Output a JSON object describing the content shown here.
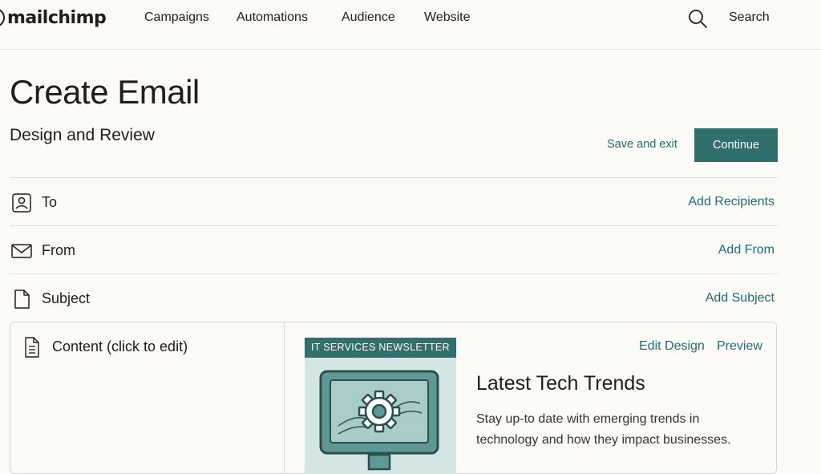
{
  "nav": {
    "logo": "mailchimp",
    "items": [
      "Campaigns",
      "Automations",
      "Audience",
      "Website"
    ],
    "search_label": "Search"
  },
  "header": {
    "title": "Create Email",
    "subtitle": "Design and Review",
    "save_exit": "Save and exit",
    "continue": "Continue"
  },
  "fields": {
    "to": {
      "label": "To",
      "action": "Add Recipients",
      "icon": "user-card-icon"
    },
    "from": {
      "label": "From",
      "action": "Add From",
      "icon": "envelope-icon"
    },
    "subject": {
      "label": "Subject",
      "action": "Add Subject",
      "icon": "document-icon"
    }
  },
  "content": {
    "label": "Content (click to edit)",
    "icon": "document-lines-icon",
    "edit_design": "Edit Design",
    "preview": "Preview",
    "card_tag": "IT SERVICES NEWSLETTER",
    "card_image_icon": "monitor-gear-icon",
    "article_title": "Latest Tech Trends",
    "article_body": "Stay up-to date with emerging trends in technology and how they impact businesses."
  },
  "colors": {
    "accent": "#2f6f6c",
    "link": "#1f6e6e",
    "text": "#241c15",
    "background": "#fbfaf7",
    "card_bg": "#d4e6e4"
  }
}
